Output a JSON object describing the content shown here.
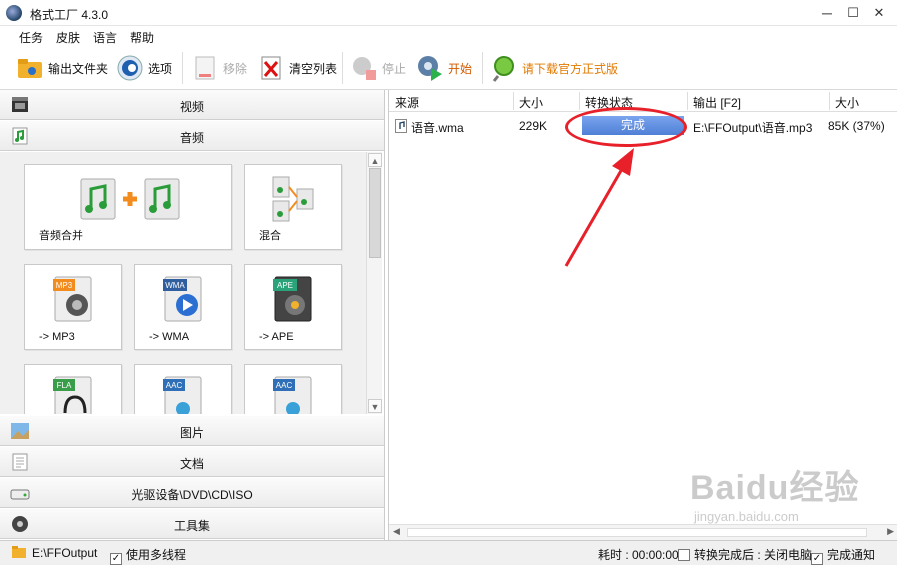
{
  "window": {
    "title": "格式工厂 4.3.0",
    "minimize": "─",
    "maximize": "☐",
    "close": "✕"
  },
  "menu": [
    "任务",
    "皮肤",
    "语言",
    "帮助"
  ],
  "toolbar": {
    "output_folder": "输出文件夹",
    "options": "选项",
    "remove": "移除",
    "clear_list": "清空列表",
    "stop": "停止",
    "start": "开始",
    "download": "请下载官方正式版"
  },
  "categories": {
    "video": "视频",
    "audio": "音频",
    "image": "图片",
    "document": "文档",
    "rom": "光驱设备\\DVD\\CD\\ISO",
    "tools": "工具集"
  },
  "audio_tiles": [
    {
      "label": "音频合并",
      "badge": ""
    },
    {
      "label": "混合",
      "badge": ""
    },
    {
      "label": "-> MP3",
      "badge": "MP3"
    },
    {
      "label": "-> WMA",
      "badge": "WMA"
    },
    {
      "label": "-> APE",
      "badge": "APE"
    },
    {
      "label": "",
      "badge": "FLA"
    },
    {
      "label": "",
      "badge": "AAC"
    },
    {
      "label": "",
      "badge": "AAC"
    }
  ],
  "table": {
    "headers": [
      "来源",
      "大小",
      "转换状态",
      "输出 [F2]",
      "大小"
    ],
    "rows": [
      {
        "source": "语音.wma",
        "size": "229K",
        "status": "完成",
        "output": "E:\\FFOutput\\语音.mp3",
        "out_size": "85K  (37%)"
      }
    ]
  },
  "statusbar": {
    "output_path": "E:\\FFOutput",
    "multithread": "使用多线程",
    "elapsed": "耗时 : 00:00:00",
    "after_done": "转换完成后 : 关闭电脑",
    "notify": "完成通知"
  },
  "watermark": {
    "brand": "Baidu经验",
    "url": "jingyan.baidu.com"
  },
  "colors": {
    "status_complete": "#4f7fd6",
    "annotation": "#e8202a",
    "accent_orange": "#f28c1f"
  }
}
